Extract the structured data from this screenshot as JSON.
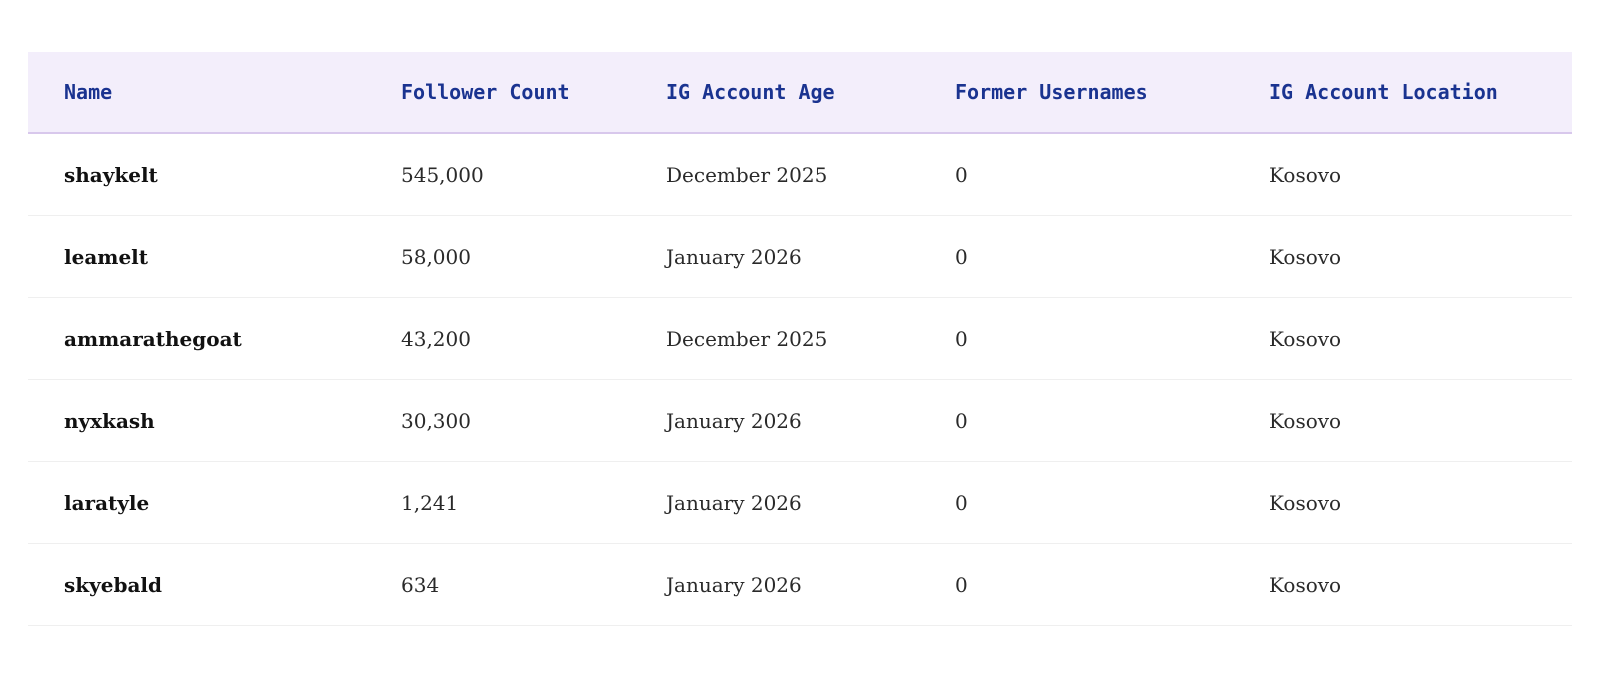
{
  "table": {
    "headers": [
      "Name",
      "Follower Count",
      "IG Account Age",
      "Former Usernames",
      "IG Account Location"
    ],
    "rows": [
      [
        "shaykelt",
        "545,000",
        "December 2025",
        "0",
        "Kosovo"
      ],
      [
        "leamelt",
        "58,000",
        "January 2026",
        "0",
        "Kosovo"
      ],
      [
        "ammarathegoat",
        "43,200",
        "December 2025",
        "0",
        "Kosovo"
      ],
      [
        "nyxkash",
        "30,300",
        "January 2026",
        "0",
        "Kosovo"
      ],
      [
        "laratyle",
        "1,241",
        "January 2026",
        "0",
        "Kosovo"
      ],
      [
        "skyebald",
        "634",
        "January 2026",
        "0",
        "Kosovo"
      ]
    ]
  },
  "colors": {
    "header_background": "#f3eefb",
    "header_text": "#1a3390",
    "header_border": "#d8c8ec",
    "row_border": "#efefef"
  }
}
